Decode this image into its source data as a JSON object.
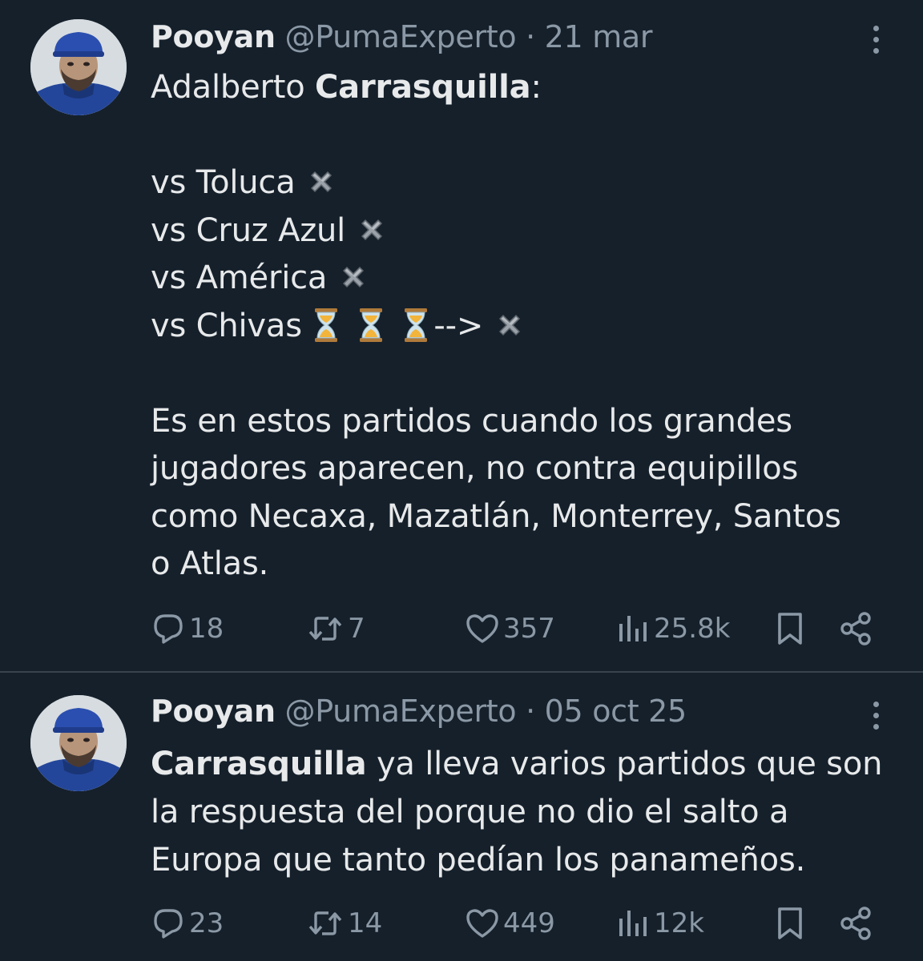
{
  "tweets": [
    {
      "author": {
        "name": "Pooyan",
        "handle": "@PumaExperto"
      },
      "separator": "·",
      "date": "21 mar",
      "lines": {
        "l1a": "Adalberto ",
        "l1b": "Carrasquilla",
        "l1c": ":",
        "t1": "vs Toluca ",
        "t2": "vs Cruz Azul ",
        "t3": "vs América ",
        "t4": "vs Chivas ",
        "t4arrow": "--> ",
        "p1": "Es en estos partidos cuando los grandes",
        "p2": "jugadores aparecen, no contra equipillos",
        "p3": "como Necaxa, Mazatlán, Monterrey, Santos",
        "p4": "o Atlas."
      },
      "emoji": {
        "cross": "heavy-multiplication-x",
        "hourglass": "hourglass"
      },
      "stats": {
        "replies": "18",
        "reposts": "7",
        "likes": "357",
        "views": "25.8k"
      }
    },
    {
      "author": {
        "name": "Pooyan",
        "handle": "@PumaExperto"
      },
      "separator": "·",
      "date": "05 oct 25",
      "lines": {
        "l1a": "Carrasquilla",
        "l1b": " ya lleva varios partidos que son",
        "l2": "la respuesta del porque no dio el salto a",
        "l3": "Europa que tanto pedían los panameños."
      },
      "stats": {
        "replies": "23",
        "reposts": "14",
        "likes": "449",
        "views": "12k"
      }
    }
  ],
  "icons": [
    "reply-icon",
    "repost-icon",
    "like-icon",
    "views-icon",
    "bookmark-icon",
    "share-icon",
    "more-icon"
  ],
  "colors": {
    "background": "#15202b",
    "text": "#e7e9ea",
    "muted": "#8b98a5",
    "divider": "#38444d"
  }
}
